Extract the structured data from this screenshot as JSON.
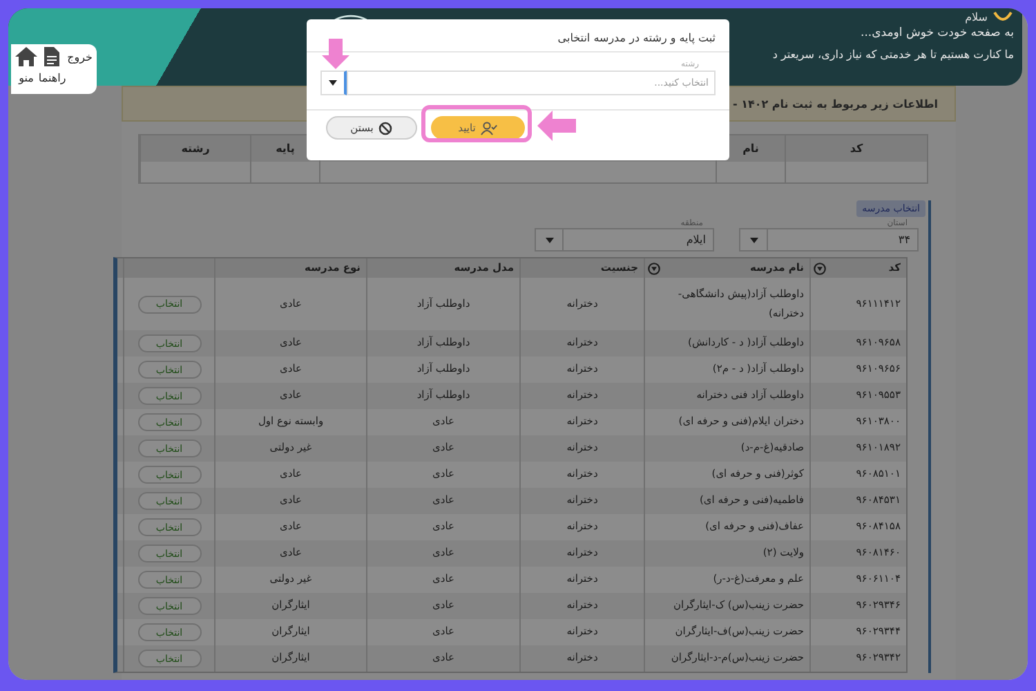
{
  "header": {
    "greeting": "سلام",
    "welcome": "به صفحه خودت خوش اومدی...",
    "message": "ما کنارت هستیم تا هر خدمتی که نیاز داری، سریعتر د"
  },
  "side_menu": {
    "items": [
      {
        "label": "خروج",
        "kind": "text"
      },
      {
        "label": "راهنما",
        "kind": "document"
      },
      {
        "label": "منو",
        "kind": "home"
      }
    ]
  },
  "notice": "اطلاعات زیر مربوط به ثبت نام ۱۴۰۲ -",
  "summary_table": {
    "columns": [
      "کد",
      "نام",
      "پایه",
      "رشته"
    ]
  },
  "school_picker": {
    "tag": "انتخاب مدرسه",
    "fields": [
      {
        "label": "استان",
        "value": "۳۴"
      },
      {
        "label": "منطقه",
        "value": "ایلام"
      }
    ]
  },
  "schools_table": {
    "columns": [
      {
        "label": "کد",
        "filter": true
      },
      {
        "label": "نام مدرسه",
        "filter": true
      },
      {
        "label": "جنسیت",
        "filter": false
      },
      {
        "label": "مدل مدرسه",
        "filter": false
      },
      {
        "label": "نوع مدرسه",
        "filter": false
      }
    ],
    "rows": [
      {
        "code": "۹۶۱۱۱۴۱۲",
        "name": "داوطلب آزاد(پیش دانشگاهی-دخترانه)",
        "gender": "دخترانه",
        "model": "داوطلب آزاد",
        "type": "عادی",
        "action": "انتخاب"
      },
      {
        "code": "۹۶۱۰۹۶۵۸",
        "name": "داوطلب آزاد( د - کاردانش)",
        "gender": "دخترانه",
        "model": "داوطلب آزاد",
        "type": "عادی",
        "action": "انتخاب"
      },
      {
        "code": "۹۶۱۰۹۶۵۶",
        "name": "داوطلب آزاد( د - م۲)",
        "gender": "دخترانه",
        "model": "داوطلب آزاد",
        "type": "عادی",
        "action": "انتخاب"
      },
      {
        "code": "۹۶۱۰۹۵۵۳",
        "name": "داوطلب آزاد فنی دخترانه",
        "gender": "دخترانه",
        "model": "داوطلب آزاد",
        "type": "عادی",
        "action": "انتخاب"
      },
      {
        "code": "۹۶۱۰۳۸۰۰",
        "name": "دختران ایلام(فنی و حرفه ای)",
        "gender": "دخترانه",
        "model": "عادی",
        "type": "وابسته نوع اول",
        "action": "انتخاب"
      },
      {
        "code": "۹۶۱۰۱۸۹۲",
        "name": "صادقیه(غ-م-د)",
        "gender": "دخترانه",
        "model": "عادی",
        "type": "غیر دولتی",
        "action": "انتخاب"
      },
      {
        "code": "۹۶۰۸۵۱۰۱",
        "name": "کوثر(فنی و حرفه ای)",
        "gender": "دخترانه",
        "model": "عادی",
        "type": "عادی",
        "action": "انتخاب"
      },
      {
        "code": "۹۶۰۸۴۵۳۱",
        "name": "فاطمیه(فنی و حرفه ای)",
        "gender": "دخترانه",
        "model": "عادی",
        "type": "عادی",
        "action": "انتخاب"
      },
      {
        "code": "۹۶۰۸۴۱۵۸",
        "name": "عفاف(فنی و حرفه ای)",
        "gender": "دخترانه",
        "model": "عادی",
        "type": "عادی",
        "action": "انتخاب"
      },
      {
        "code": "۹۶۰۸۱۴۶۰",
        "name": "ولایت (۲)",
        "gender": "دخترانه",
        "model": "عادی",
        "type": "عادی",
        "action": "انتخاب"
      },
      {
        "code": "۹۶۰۶۱۱۰۴",
        "name": "علم و معرفت(غ-د-ر)",
        "gender": "دخترانه",
        "model": "عادی",
        "type": "غیر دولتی",
        "action": "انتخاب"
      },
      {
        "code": "۹۶۰۲۹۳۴۶",
        "name": "حضرت زینب(س) ک-ایثارگران",
        "gender": "دخترانه",
        "model": "عادی",
        "type": "ایثارگران",
        "action": "انتخاب"
      },
      {
        "code": "۹۶۰۲۹۳۴۴",
        "name": "حضرت زینب(س)ف-ایثارگران",
        "gender": "دخترانه",
        "model": "عادی",
        "type": "ایثارگران",
        "action": "انتخاب"
      },
      {
        "code": "۹۶۰۲۹۳۴۲",
        "name": "حضرت زینب(س)م-د-ایثارگران",
        "gender": "دخترانه",
        "model": "عادی",
        "type": "ایثارگران",
        "action": "انتخاب"
      }
    ]
  },
  "dialog": {
    "title": "ثبت پایه و رشته در مدرسه انتخابی",
    "field": {
      "label": "رشته",
      "placeholder": "انتخاب کنید..."
    },
    "buttons": [
      {
        "label": "تایید",
        "kind": "confirm"
      },
      {
        "label": "بستن",
        "kind": "close"
      }
    ]
  }
}
